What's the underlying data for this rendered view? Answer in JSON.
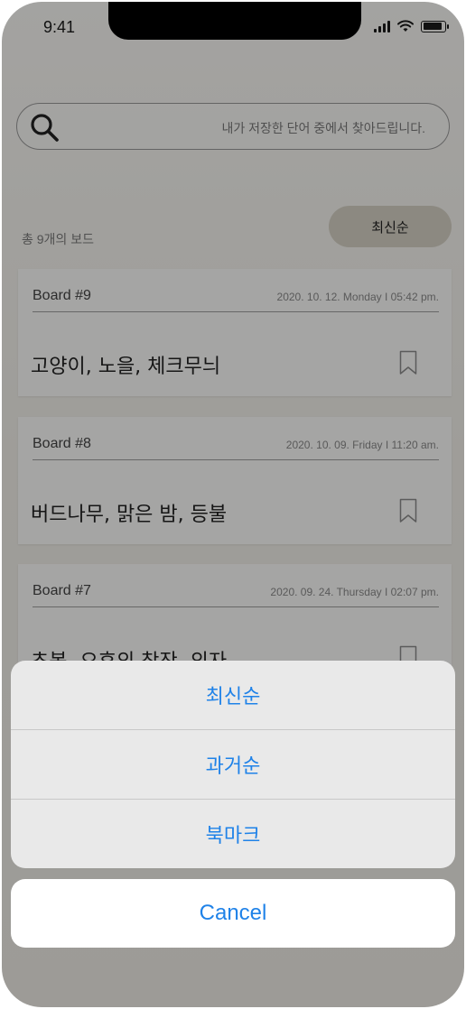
{
  "status": {
    "time": "9:41",
    "icons": [
      "signal-icon",
      "wifi-icon",
      "battery-icon"
    ]
  },
  "search": {
    "placeholder": "내가 저장한 단어 중에서 찾아드립니다.",
    "icon": "search-icon"
  },
  "list": {
    "count_label": "총 9개의 보드",
    "sort_label": "최신순",
    "cards": [
      {
        "title": "Board #9",
        "date": "2020. 10. 12. Monday  I  05:42 pm.",
        "words": "고양이, 노을, 체크무늬"
      },
      {
        "title": "Board #8",
        "date": "2020. 10. 09. Friday  I  11:20 am.",
        "words": "버드나무, 맑은 밤, 등불"
      },
      {
        "title": "Board #7",
        "date": "2020. 09. 24. Thursday  I  02:07 pm.",
        "words": "초봄, 오후의 찻잔, 의자"
      }
    ]
  },
  "action_sheet": {
    "options": [
      "최신순",
      "과거순",
      "북마크"
    ],
    "cancel_label": "Cancel"
  },
  "colors": {
    "accent": "#1f82e8",
    "sort_button_bg": "#d8d3c6",
    "overlay": "rgba(0,0,0,0.35)"
  }
}
